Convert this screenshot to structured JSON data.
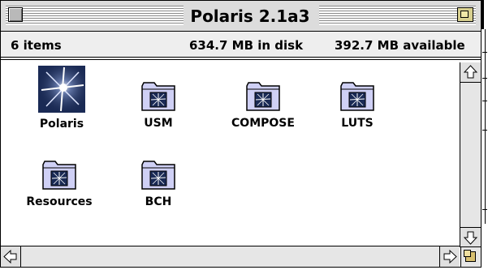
{
  "window": {
    "title": "Polaris 2.1a3"
  },
  "info": {
    "items": "6 items",
    "disk": "634.7 MB in disk",
    "available": "392.7 MB available"
  },
  "icons": [
    {
      "label": "Polaris",
      "type": "application",
      "icon": "polaris-app-icon"
    },
    {
      "label": "USM",
      "type": "folder",
      "icon": "folder-icon"
    },
    {
      "label": "COMPOSE",
      "type": "folder",
      "icon": "folder-icon"
    },
    {
      "label": "LUTS",
      "type": "folder",
      "icon": "folder-icon"
    },
    {
      "label": "Resources",
      "type": "folder",
      "icon": "folder-icon"
    },
    {
      "label": "BCH",
      "type": "folder",
      "icon": "folder-icon"
    }
  ],
  "colors": {
    "titlebar": "#dcdcdc",
    "folder": "#cfd0f5",
    "app_icon_bg": "#1a2a55"
  }
}
